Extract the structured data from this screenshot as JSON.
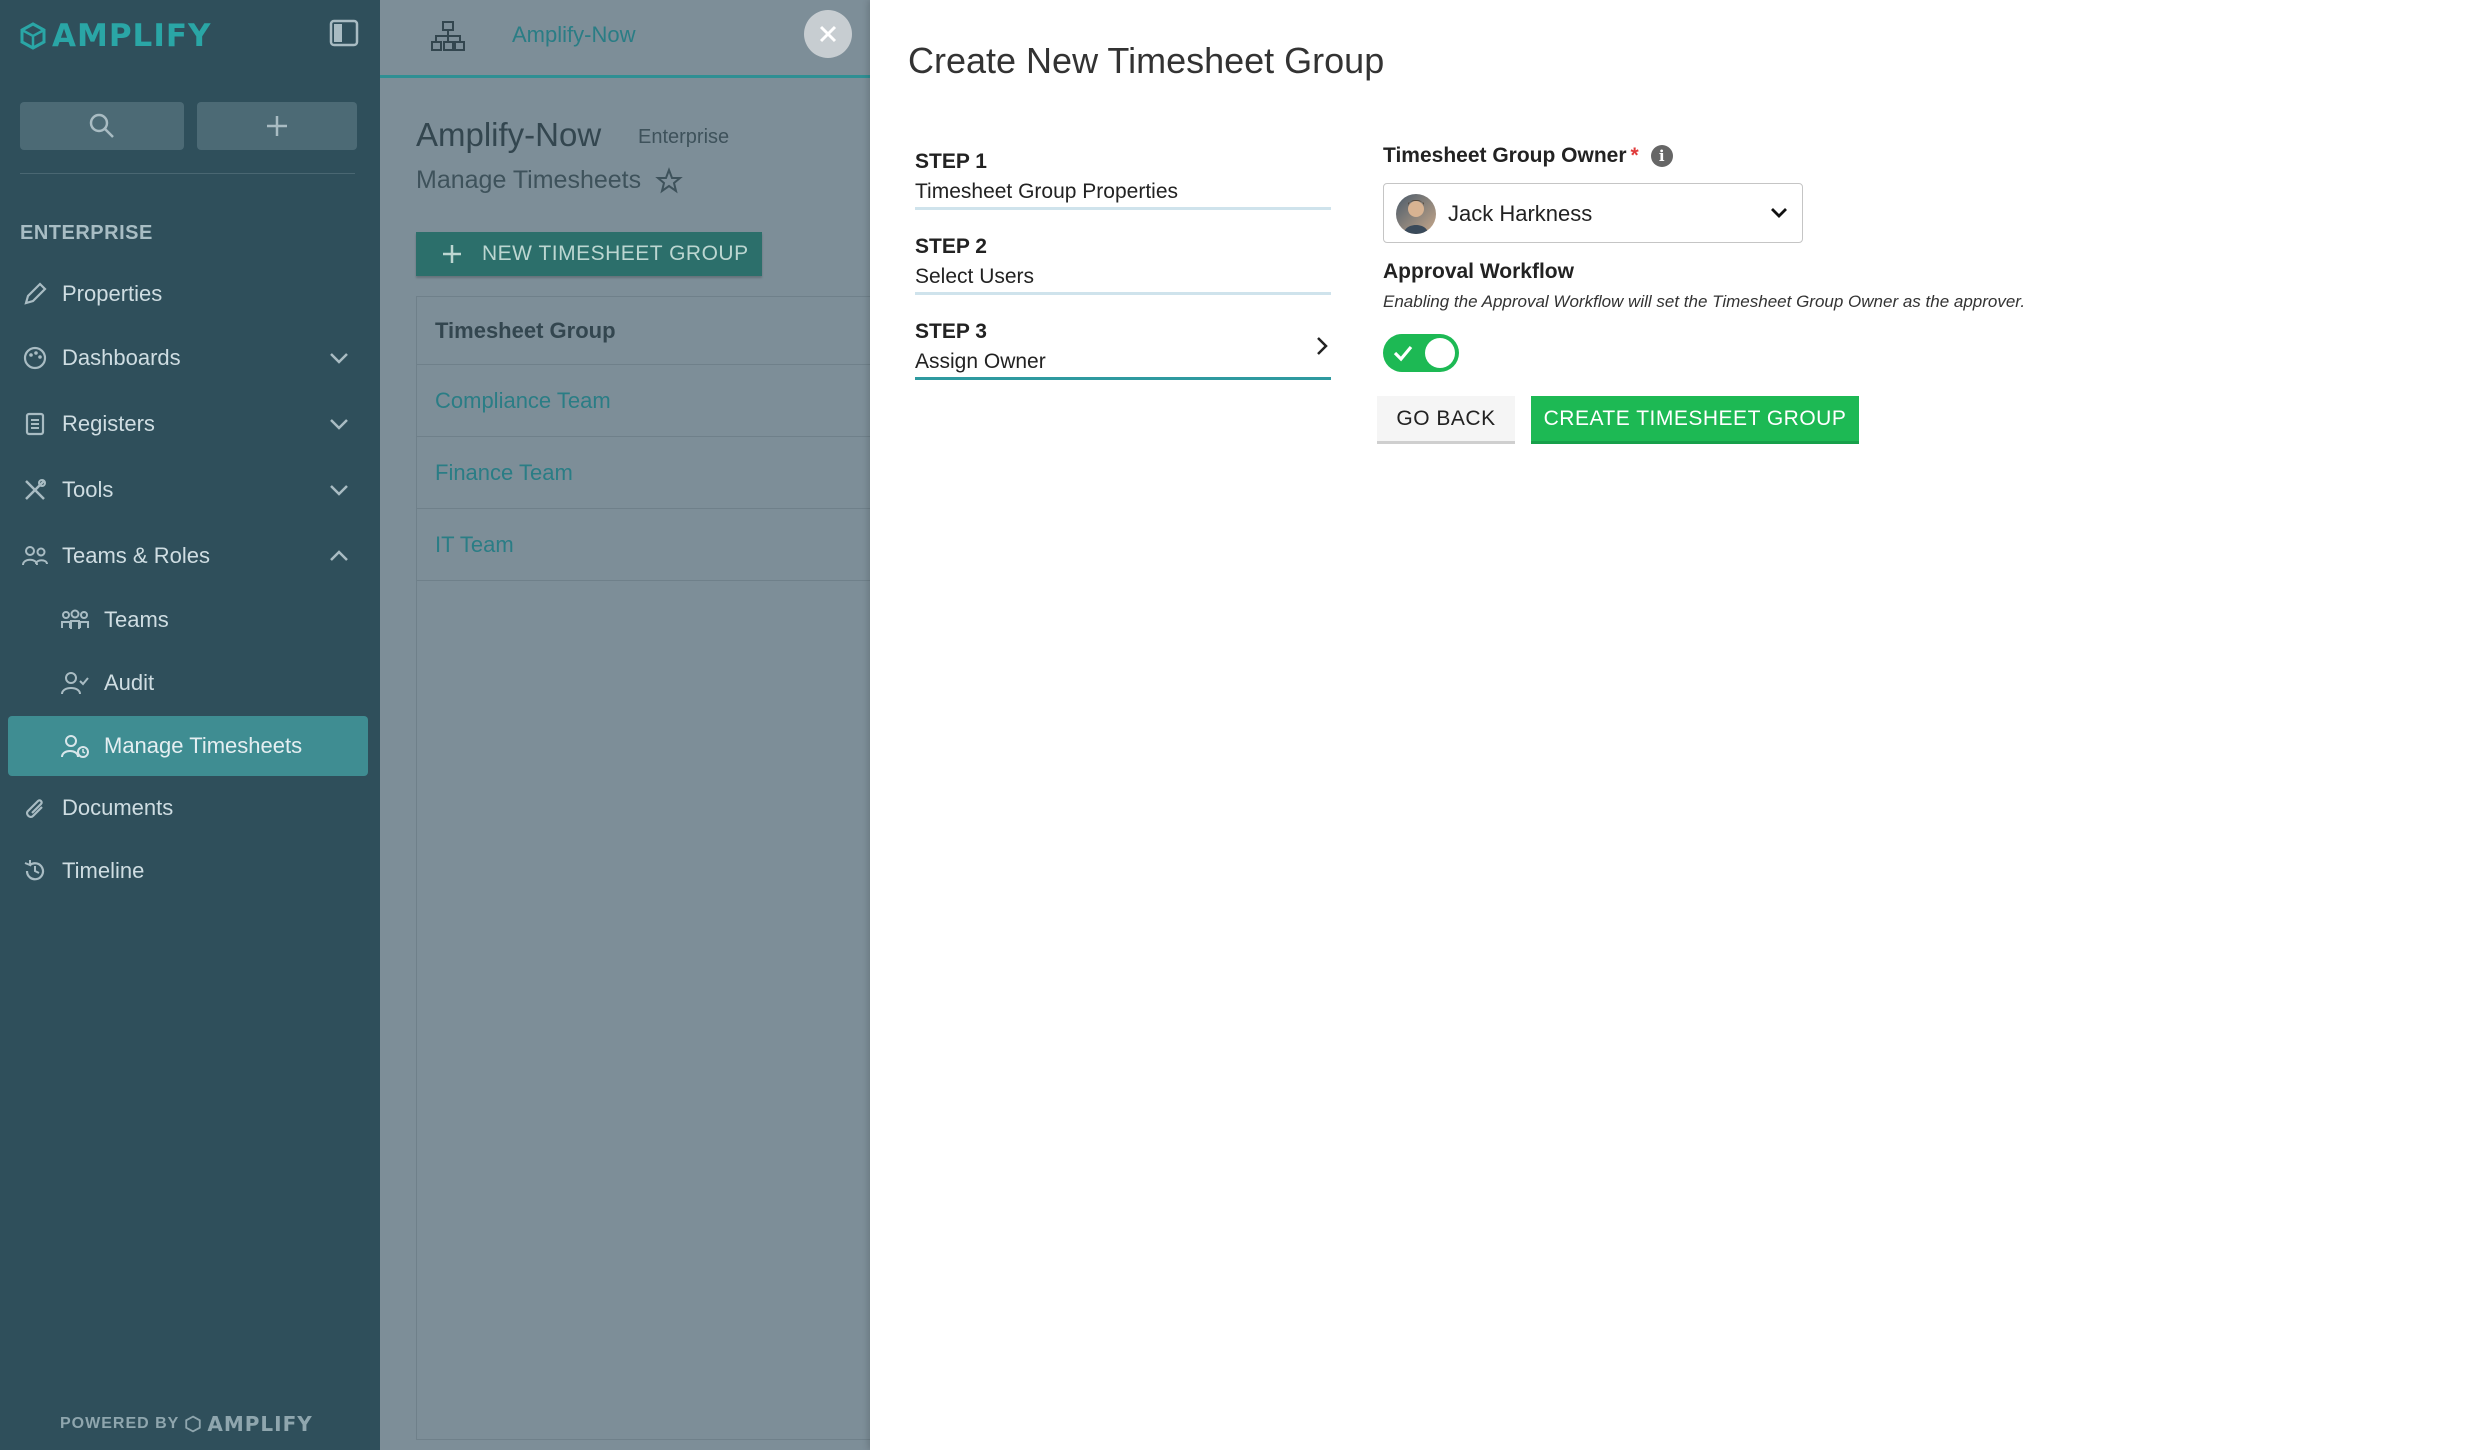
{
  "sidebar": {
    "logo_text": "AMPLIFY",
    "section_label": "ENTERPRISE",
    "items": [
      {
        "label": "Properties"
      },
      {
        "label": "Dashboards"
      },
      {
        "label": "Registers"
      },
      {
        "label": "Tools"
      },
      {
        "label": "Teams & Roles"
      },
      {
        "label": "Teams"
      },
      {
        "label": "Audit"
      },
      {
        "label": "Manage Timesheets"
      },
      {
        "label": "Documents"
      },
      {
        "label": "Timeline"
      }
    ],
    "powered_by": "POWERED BY",
    "powered_brand": "AMPLIFY"
  },
  "topbar": {
    "crumb": "Amplify-Now"
  },
  "page": {
    "title": "Amplify-Now",
    "tag": "Enterprise",
    "subtitle": "Manage Timesheets",
    "new_button": "NEW TIMESHEET GROUP",
    "table_header": "Timesheet Group",
    "rows": [
      "Compliance Team",
      "Finance Team",
      "IT Team"
    ]
  },
  "drawer": {
    "title": "Create New Timesheet Group",
    "steps": [
      {
        "num": "STEP 1",
        "name": "Timesheet Group Properties"
      },
      {
        "num": "STEP 2",
        "name": "Select Users"
      },
      {
        "num": "STEP 3",
        "name": "Assign Owner"
      }
    ],
    "owner_label": "Timesheet Group Owner",
    "required_mark": "*",
    "owner_value": "Jack Harkness",
    "workflow_title": "Approval Workflow",
    "workflow_desc": "Enabling the Approval Workflow will set the Timesheet Group Owner as the approver.",
    "workflow_enabled": true,
    "go_back": "GO BACK",
    "create": "CREATE TIMESHEET GROUP"
  },
  "colors": {
    "sidebar_bg": "#2f4f5b",
    "active_item": "#3f8d92",
    "primary_green": "#1db954",
    "accent_teal": "#2aa6a6"
  }
}
